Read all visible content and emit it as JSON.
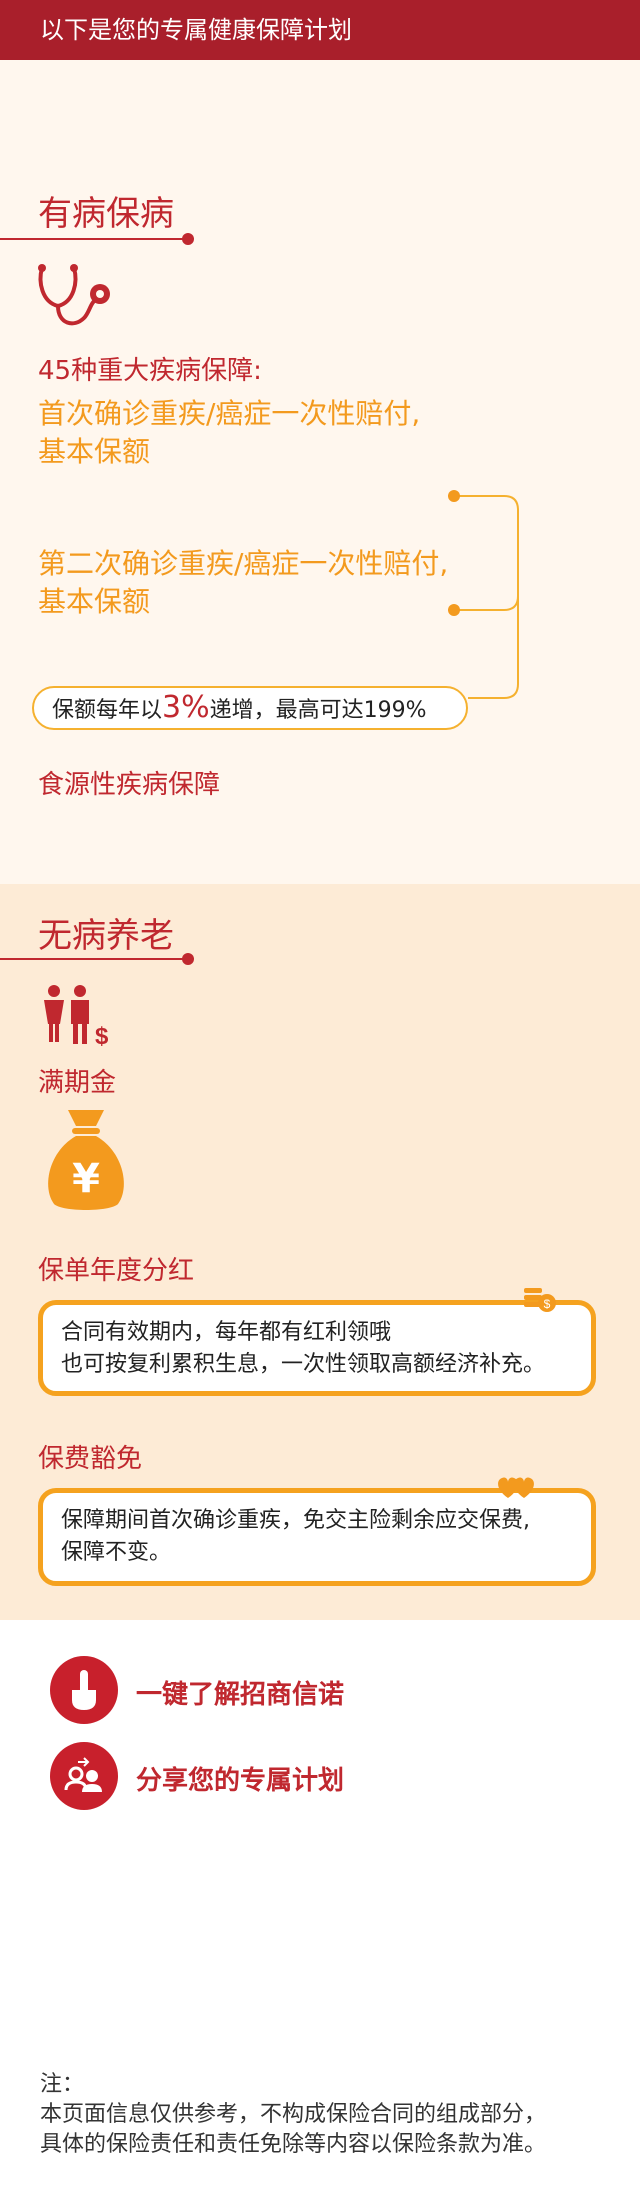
{
  "header": {
    "title": "以下是您的专属健康保障计划"
  },
  "sick": {
    "title": "有病保病",
    "icon": "stethoscope-icon",
    "diseases_label": "45种重大疾病保障:",
    "first_claim": {
      "line1": "首次确诊重疾/癌症一次性赔付,",
      "line2": "基本保额"
    },
    "second_claim": {
      "line1": "第二次确诊重疾/癌症一次性赔付,",
      "line2": "基本保额"
    },
    "growth": {
      "prefix": "保额每年以",
      "rate": "3%",
      "suffix": "递增，最高可达199%"
    },
    "food_label": "食源性疾病保障"
  },
  "healthy": {
    "title": "无病养老",
    "couple_icon": "couple-money-icon",
    "maturity_label": "满期金",
    "money_bag_icon": "money-bag-icon",
    "money_bag_symbol": "¥",
    "dividend_label": "保单年度分红",
    "dividend_box": {
      "line1": "合同有效期内，每年都有红利领哦",
      "line2": "也可按复利累积生息，一次性领取高额经济补充。"
    },
    "waiver_label": "保费豁免",
    "waiver_box": {
      "line1": "保障期间首次确诊重疾，免交主险剩余应交保费,",
      "line2": "保障不变。"
    }
  },
  "actions": [
    {
      "label": "一键了解招商信诺",
      "icon": "hand-pointer-icon"
    },
    {
      "label": "分享您的专属计划",
      "icon": "share-people-icon"
    }
  ],
  "note": {
    "title": "注：",
    "line1": "本页面信息仅供参考，不构成保险合同的组成部分，",
    "line2": "具体的保险责任和责任免除等内容以保险条款为准。"
  },
  "colors": {
    "brand_red": "#a91f2b",
    "accent_orange": "#f39a1e"
  }
}
